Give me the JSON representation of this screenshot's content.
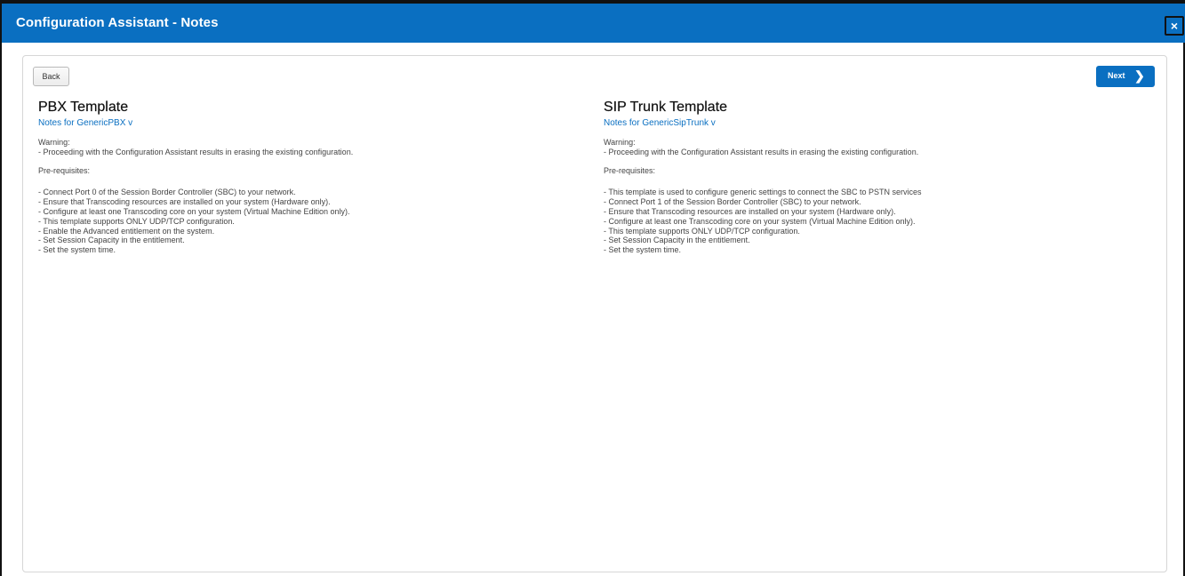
{
  "window": {
    "title": "Configuration Assistant - Notes",
    "close_label": "×"
  },
  "nav": {
    "back_label": "Back",
    "next_label": "Next",
    "next_icon": "chevron-right-icon"
  },
  "pbx": {
    "heading": "PBX Template",
    "subtitle": "Notes for GenericPBX v",
    "warning_title": "Warning:",
    "warning_lines": [
      "- Proceeding with the Configuration Assistant results in erasing the existing configuration."
    ],
    "prereq_title": "Pre-requisites:",
    "prereq_lines": [
      "- Connect Port 0 of the Session Border Controller (SBC) to your network.",
      "- Ensure that Transcoding resources are installed on your system (Hardware only).",
      "- Configure at least one Transcoding core on your system (Virtual Machine Edition only).",
      "- This template supports ONLY UDP/TCP configuration.",
      "- Enable the Advanced entitlement on the system.",
      "- Set Session Capacity in the entitlement.",
      "- Set the system time."
    ]
  },
  "sip": {
    "heading": "SIP Trunk Template",
    "subtitle": "Notes for GenericSipTrunk v",
    "warning_title": "Warning:",
    "warning_lines": [
      "- Proceeding with the Configuration Assistant results in erasing the existing configuration."
    ],
    "prereq_title": "Pre-requisites:",
    "prereq_lines": [
      "- This template is used to configure generic settings to connect the SBC to PSTN services",
      "- Connect Port 1 of the Session Border Controller (SBC) to your network.",
      "- Ensure that Transcoding resources are installed on your system (Hardware only).",
      "- Configure at least one Transcoding core on your system (Virtual Machine Edition only).",
      "- This template supports ONLY UDP/TCP configuration.",
      "- Set Session Capacity in the entitlement.",
      "- Set the system time."
    ]
  }
}
